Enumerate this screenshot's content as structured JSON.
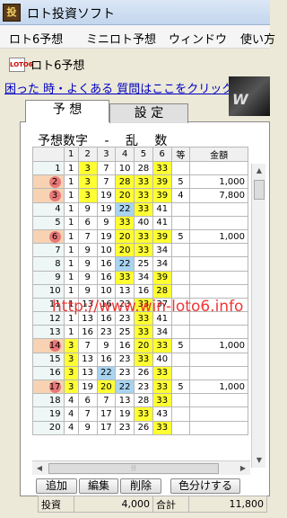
{
  "window": {
    "title": "ロト投資ソフト",
    "icon_text": "投"
  },
  "menu": {
    "items": [
      "ロト6予想",
      "ミニロト予想",
      "ウィンドウ",
      "使い方"
    ]
  },
  "document": {
    "icon_text": "LOTO6",
    "title": "ロト6予想"
  },
  "help_link": "困った 時・よくある 質問はここをクリック",
  "banner": {
    "text": "W"
  },
  "tabs": {
    "prediction": "予 想",
    "settings": "設 定"
  },
  "grid": {
    "title": "予想数字　 -　 乱　 数",
    "columns": [
      "1",
      "2",
      "3",
      "4",
      "5",
      "6",
      "等",
      "金額"
    ],
    "rows": [
      {
        "no": "1",
        "marked": false,
        "n": [
          "1",
          "3",
          "7",
          "10",
          "28",
          "33"
        ],
        "hl": [
          "",
          "y",
          "",
          "",
          "",
          "y"
        ],
        "rank": "",
        "amount": ""
      },
      {
        "no": "2",
        "marked": true,
        "n": [
          "1",
          "3",
          "7",
          "28",
          "33",
          "39"
        ],
        "hl": [
          "",
          "y",
          "",
          "y",
          "y",
          "y"
        ],
        "rank": "5",
        "amount": "1,000"
      },
      {
        "no": "3",
        "marked": true,
        "n": [
          "1",
          "3",
          "19",
          "20",
          "33",
          "39"
        ],
        "hl": [
          "",
          "y",
          "",
          "y",
          "y",
          "y"
        ],
        "rank": "4",
        "amount": "7,800"
      },
      {
        "no": "4",
        "marked": false,
        "n": [
          "1",
          "9",
          "19",
          "22",
          "33",
          "41"
        ],
        "hl": [
          "",
          "",
          "",
          "b",
          "y",
          ""
        ],
        "rank": "",
        "amount": ""
      },
      {
        "no": "5",
        "marked": false,
        "n": [
          "1",
          "6",
          "9",
          "33",
          "40",
          "41"
        ],
        "hl": [
          "",
          "",
          "",
          "y",
          "",
          ""
        ],
        "rank": "",
        "amount": ""
      },
      {
        "no": "6",
        "marked": true,
        "n": [
          "1",
          "7",
          "19",
          "20",
          "33",
          "39"
        ],
        "hl": [
          "",
          "",
          "",
          "y",
          "y",
          "y"
        ],
        "rank": "5",
        "amount": "1,000"
      },
      {
        "no": "7",
        "marked": false,
        "n": [
          "1",
          "9",
          "10",
          "20",
          "33",
          "34"
        ],
        "hl": [
          "",
          "",
          "",
          "y",
          "y",
          ""
        ],
        "rank": "",
        "amount": ""
      },
      {
        "no": "8",
        "marked": false,
        "n": [
          "1",
          "9",
          "16",
          "22",
          "25",
          "34"
        ],
        "hl": [
          "",
          "",
          "",
          "b",
          "",
          ""
        ],
        "rank": "",
        "amount": ""
      },
      {
        "no": "9",
        "marked": false,
        "n": [
          "1",
          "9",
          "16",
          "33",
          "34",
          "39"
        ],
        "hl": [
          "",
          "",
          "",
          "y",
          "",
          "y"
        ],
        "rank": "",
        "amount": ""
      },
      {
        "no": "10",
        "marked": false,
        "n": [
          "1",
          "9",
          "10",
          "13",
          "16",
          "28",
          "33"
        ],
        "hl": [
          "",
          "",
          "",
          "",
          "",
          "y"
        ],
        "rank": "",
        "amount": ""
      },
      {
        "no": "11",
        "marked": false,
        "n": [
          "1",
          "13",
          "16",
          "23",
          "33",
          "37"
        ],
        "hl": [
          "",
          "",
          "",
          "",
          "y",
          ""
        ],
        "rank": "",
        "amount": ""
      },
      {
        "no": "12",
        "marked": false,
        "n": [
          "1",
          "13",
          "16",
          "23",
          "33",
          "41"
        ],
        "hl": [
          "",
          "",
          "",
          "",
          "y",
          ""
        ],
        "rank": "",
        "amount": ""
      },
      {
        "no": "13",
        "marked": false,
        "n": [
          "1",
          "16",
          "23",
          "25",
          "33",
          "34"
        ],
        "hl": [
          "",
          "",
          "",
          "",
          "y",
          ""
        ],
        "rank": "",
        "amount": ""
      },
      {
        "no": "14",
        "marked": true,
        "n": [
          "3",
          "7",
          "9",
          "16",
          "20",
          "33"
        ],
        "hl": [
          "y",
          "",
          "",
          "",
          "y",
          "y"
        ],
        "rank": "5",
        "amount": "1,000"
      },
      {
        "no": "15",
        "marked": false,
        "n": [
          "3",
          "13",
          "16",
          "23",
          "33",
          "40"
        ],
        "hl": [
          "y",
          "",
          "",
          "",
          "y",
          ""
        ],
        "rank": "",
        "amount": ""
      },
      {
        "no": "16",
        "marked": false,
        "n": [
          "3",
          "13",
          "22",
          "23",
          "26",
          "33"
        ],
        "hl": [
          "y",
          "",
          "b",
          "",
          "",
          "y"
        ],
        "rank": "",
        "amount": ""
      },
      {
        "no": "17",
        "marked": true,
        "n": [
          "3",
          "19",
          "20",
          "22",
          "23",
          "33"
        ],
        "hl": [
          "y",
          "",
          "y",
          "b",
          "",
          "y"
        ],
        "rank": "5",
        "amount": "1,000"
      },
      {
        "no": "18",
        "marked": false,
        "n": [
          "4",
          "6",
          "7",
          "13",
          "28",
          "33"
        ],
        "hl": [
          "",
          "",
          "",
          "",
          "",
          "y"
        ],
        "rank": "",
        "amount": ""
      },
      {
        "no": "19",
        "marked": false,
        "n": [
          "4",
          "7",
          "17",
          "19",
          "33",
          "43"
        ],
        "hl": [
          "",
          "",
          "",
          "",
          "y",
          ""
        ],
        "rank": "",
        "amount": ""
      },
      {
        "no": "20",
        "marked": false,
        "n": [
          "4",
          "9",
          "17",
          "23",
          "26",
          "33"
        ],
        "hl": [
          "",
          "",
          "",
          "",
          "",
          "y"
        ],
        "rank": "",
        "amount": ""
      }
    ]
  },
  "buttons": {
    "add": "追加",
    "edit": "編集",
    "delete": "削除",
    "split": "色分けする"
  },
  "totals": {
    "invest_label": "投資",
    "invest_value": "4,000",
    "total_label": "合計",
    "total_value": "11,800"
  },
  "watermark": "http://www.win-loto6.info",
  "colors": {
    "highlight_yellow": "#ffff33",
    "highlight_blue": "#a8d4f0",
    "marker_red": "#e87878"
  }
}
